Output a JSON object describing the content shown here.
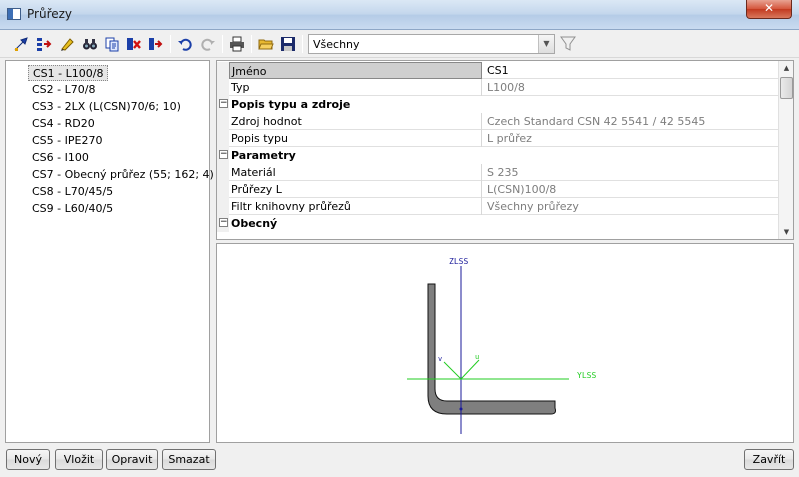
{
  "window": {
    "title": "Průřezy",
    "close_label": "✕"
  },
  "toolbar": {
    "icons": [
      "new-section-icon",
      "insert-icon",
      "edit-icon",
      "binoculars-icon",
      "copy-icon",
      "delete-icon",
      "export-icon",
      "undo-icon",
      "redo-icon",
      "print-icon",
      "open-folder-icon",
      "save-icon",
      "filter-icon"
    ],
    "filter_value": "Všechny"
  },
  "sections": [
    {
      "label": "CS1 - L100/8",
      "selected": true
    },
    {
      "label": "CS2 - L70/8"
    },
    {
      "label": "CS3 - 2LX (L(CSN)70/6; 10)"
    },
    {
      "label": "CS4 - RD20"
    },
    {
      "label": "CS5 - IPE270"
    },
    {
      "label": "CS6 - I100"
    },
    {
      "label": "CS7 - Obecný průřez (55; 162; 4)"
    },
    {
      "label": "CS8 - L70/45/5"
    },
    {
      "label": "CS9 - L60/40/5"
    }
  ],
  "properties": {
    "rows": [
      {
        "name": "Jméno",
        "value": "CS1"
      },
      {
        "name": "Typ",
        "value": "L100/8"
      },
      {
        "category": "Popis typu a zdroje"
      },
      {
        "name": "Zdroj hodnot",
        "value": "Czech Standard CSN 42 5541 / 42 5545"
      },
      {
        "name": "Popis typu",
        "value": "L průřez"
      },
      {
        "category": "Parametry"
      },
      {
        "name": "Materiál",
        "value": "S 235"
      },
      {
        "name": "Průřezy L",
        "value": "L(CSN)100/8"
      },
      {
        "name": "Filtr knihovny průřezů",
        "value": "Všechny průřezy"
      },
      {
        "category": "Obecný"
      }
    ]
  },
  "drawing": {
    "axis_z_label": "ZLSS",
    "axis_y_label": "YLSS",
    "axis_v_label": "v",
    "axis_u_label": "u",
    "colors": {
      "axis_z": "#1a1a9a",
      "axis_y": "#22cc22",
      "section_fill": "#7f7f7f"
    }
  },
  "buttons": {
    "new": "Nový",
    "insert": "Vložit",
    "edit": "Opravit",
    "delete": "Smazat",
    "close": "Zavřít"
  }
}
